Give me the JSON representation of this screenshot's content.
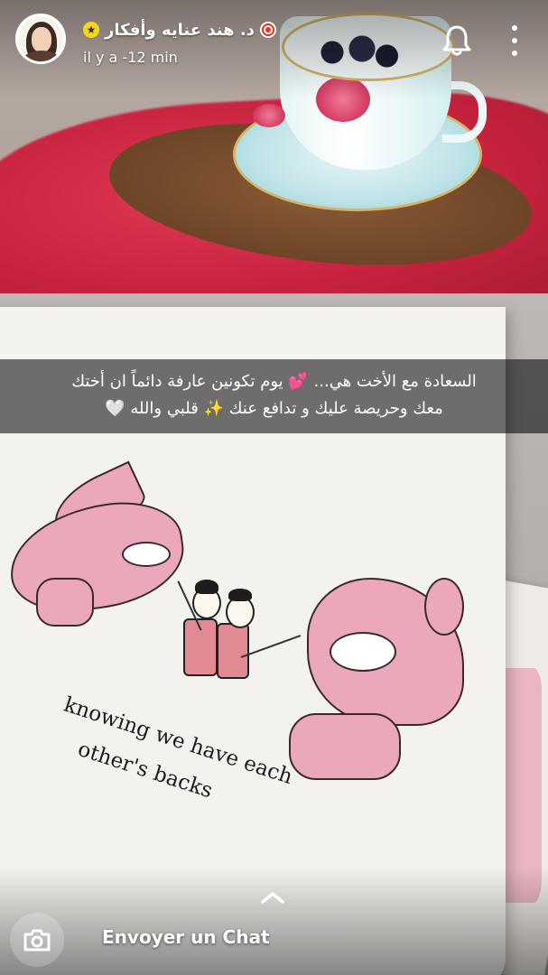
{
  "header": {
    "user_name": "د. هند عنايه وأفكار",
    "time_ago": "il y a -12 min"
  },
  "caption": {
    "line1": "السعادة مع الأخت هي... 💕 يوم تكونين عارفة دائماً ان أختك",
    "line2": "معك وحريصة عليك و تدافع عنك ✨ قلبي والله 🤍"
  },
  "illustration_text": {
    "line1": "knowing we have each",
    "line2": "other's backs"
  },
  "footer": {
    "chat_label": "Envoyer un Chat"
  },
  "icons": {
    "star": "star-badge-icon",
    "target": "target-icon",
    "bell": "bell-icon",
    "more": "more-icon",
    "camera": "camera-icon",
    "chevron": "chevron-up-icon"
  },
  "colors": {
    "badge_yellow": "#f7d51c",
    "caption_bg": "rgba(0,0,0,0.55)"
  }
}
